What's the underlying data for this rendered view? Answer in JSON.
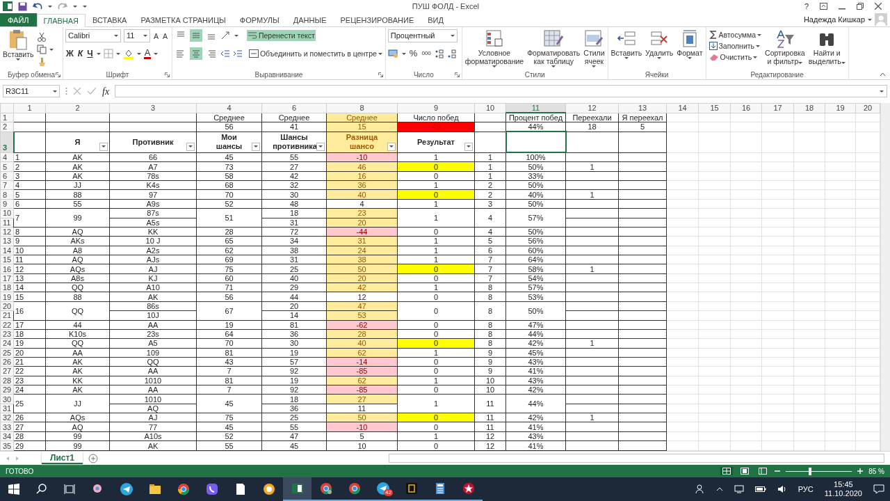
{
  "title_bar": {
    "title": "ПУШ ФОЛД - Excel",
    "help": "?"
  },
  "ribbon_tabs": [
    {
      "label": "ФАЙЛ",
      "kind": "file",
      "selected": false
    },
    {
      "label": "ГЛАВНАЯ",
      "kind": "tab",
      "selected": true
    },
    {
      "label": "ВСТАВКА",
      "kind": "tab",
      "selected": false
    },
    {
      "label": "РАЗМЕТКА СТРАНИЦЫ",
      "kind": "tab",
      "selected": false
    },
    {
      "label": "ФОРМУЛЫ",
      "kind": "tab",
      "selected": false
    },
    {
      "label": "ДАННЫЕ",
      "kind": "tab",
      "selected": false
    },
    {
      "label": "РЕЦЕНЗИРОВАНИЕ",
      "kind": "tab",
      "selected": false
    },
    {
      "label": "ВИД",
      "kind": "tab",
      "selected": false
    }
  ],
  "user": {
    "name": "Надежда Кишкар"
  },
  "ribbon_groups": [
    {
      "kind": "clipboard",
      "label": "Буфер обмена",
      "paste": "Вставить"
    },
    {
      "kind": "font",
      "label": "Шрифт",
      "font": "Calibri",
      "size": "11",
      "grow": "A",
      "shrink": "A",
      "bold": "Ж",
      "italic": "К",
      "underline": "Ч",
      "font_color": "A"
    },
    {
      "kind": "alignment",
      "label": "Выравнивание",
      "vertical": [
        {
          "selected": false
        },
        {
          "selected": true
        },
        {
          "selected": false
        }
      ],
      "horizontal": [
        {
          "selected": false
        },
        {
          "selected": true
        },
        {
          "selected": false
        }
      ],
      "wrap": {
        "label": "Перенести текст",
        "selected": true
      },
      "merge": "Объединить и поместить в центре"
    },
    {
      "kind": "number",
      "label": "Число",
      "format": "Процентный",
      "percent": "%",
      "thousands": "000"
    },
    {
      "kind": "styles",
      "label": "Стили",
      "buttons": [
        {
          "lines": [
            "Условное",
            "форматирование"
          ]
        },
        {
          "lines": [
            "Форматировать",
            "как таблицу"
          ]
        },
        {
          "lines": [
            "Стили",
            "ячеек"
          ]
        }
      ]
    },
    {
      "kind": "cells",
      "label": "Ячейки",
      "buttons": [
        {
          "lines": [
            "Вставить"
          ]
        },
        {
          "lines": [
            "Удалить"
          ]
        },
        {
          "lines": [
            "Формат"
          ]
        }
      ]
    },
    {
      "kind": "editing",
      "label": "Редактирование",
      "small": [
        "Автосумма",
        "Заполнить",
        "Очистить"
      ],
      "buttons": [
        {
          "lines": [
            "Сортировка",
            "и фильтр"
          ]
        },
        {
          "lines": [
            "Найти и",
            "выделить"
          ]
        }
      ]
    }
  ],
  "formula_bar": {
    "name_box": "R3C11",
    "fx": "fx"
  },
  "column_headers": [
    {
      "label": "1",
      "selected": false
    },
    {
      "label": "2",
      "selected": false
    },
    {
      "label": "3",
      "selected": false
    },
    {
      "label": "4",
      "selected": false
    },
    {
      "label": "6",
      "selected": false
    },
    {
      "label": "8",
      "selected": false
    },
    {
      "label": "9",
      "selected": false
    },
    {
      "label": "10",
      "selected": false
    },
    {
      "label": "11",
      "selected": true
    },
    {
      "label": "12",
      "selected": false
    },
    {
      "label": "13",
      "selected": false
    },
    {
      "label": "14",
      "selected": false
    },
    {
      "label": "15",
      "selected": false
    },
    {
      "label": "16",
      "selected": false
    },
    {
      "label": "17",
      "selected": false
    },
    {
      "label": "18",
      "selected": false
    },
    {
      "label": "19",
      "selected": false
    },
    {
      "label": "20",
      "selected": false
    }
  ],
  "summary_rows": [
    {
      "row": "1",
      "cells": [
        null,
        null,
        null,
        {
          "text": "Среднее",
          "kind": "plain"
        },
        {
          "text": "Среднее",
          "kind": "plain"
        },
        {
          "text": "Среднее",
          "kind": "neutral"
        },
        {
          "text": "Число побед",
          "kind": "plain"
        },
        null,
        {
          "text": "Процент побед",
          "kind": "plain"
        },
        {
          "text": "Переехали",
          "kind": "plain"
        },
        {
          "text": "Я переехал",
          "kind": "plain"
        }
      ]
    },
    {
      "row": "2",
      "cells": [
        null,
        null,
        null,
        {
          "text": "56",
          "kind": "plain"
        },
        {
          "text": "41",
          "kind": "plain"
        },
        {
          "text": "15",
          "kind": "neutral"
        },
        {
          "text": "49",
          "kind": "alert"
        },
        null,
        {
          "text": "44%",
          "kind": "plain"
        },
        {
          "text": "18",
          "kind": "plain"
        },
        {
          "text": "5",
          "kind": "plain"
        }
      ]
    }
  ],
  "header_row": {
    "row": "3",
    "selected": true,
    "cells": [
      {
        "filter": false,
        "selected": false
      },
      {
        "text": "Я",
        "filter": true,
        "selected": false
      },
      {
        "text": "Противник",
        "filter": true,
        "selected": false
      },
      {
        "text": "Мои шансы",
        "filter": true,
        "selected": false
      },
      {
        "text": "Шансы противника",
        "filter": true,
        "selected": false
      },
      {
        "text": "Разница шансо",
        "filter": true,
        "selected": false,
        "kind": "neutral"
      },
      {
        "text": "Результат",
        "filter": true,
        "selected": false
      },
      {
        "filter": false,
        "selected": false
      },
      {
        "filter": false,
        "selected": true
      },
      {
        "filter": false,
        "selected": false
      },
      {
        "filter": false,
        "selected": false
      }
    ]
  },
  "entries": [
    {
      "rows": [
        "4"
      ],
      "num": "1",
      "me": "AK",
      "opponents": [
        "66"
      ],
      "my": "45",
      "their": [
        "55"
      ],
      "diff": [
        {
          "text": "-10",
          "kind": "bad"
        }
      ],
      "result": {
        "text": "1",
        "highlight": false
      },
      "wins": "1",
      "pct": "100%"
    },
    {
      "rows": [
        "5"
      ],
      "num": "2",
      "me": "AK",
      "opponents": [
        "A7"
      ],
      "my": "73",
      "their": [
        "27"
      ],
      "diff": [
        {
          "text": "46",
          "kind": "neutral"
        }
      ],
      "result": {
        "text": "0",
        "highlight": true
      },
      "wins": "1",
      "pct": "50%",
      "moved": "1"
    },
    {
      "rows": [
        "6"
      ],
      "num": "3",
      "me": "AK",
      "opponents": [
        "78s"
      ],
      "my": "58",
      "their": [
        "42"
      ],
      "diff": [
        {
          "text": "16",
          "kind": "neutral"
        }
      ],
      "result": {
        "text": "0",
        "highlight": false
      },
      "wins": "1",
      "pct": "33%"
    },
    {
      "rows": [
        "7"
      ],
      "num": "4",
      "me": "JJ",
      "opponents": [
        "K4s"
      ],
      "my": "68",
      "their": [
        "32"
      ],
      "diff": [
        {
          "text": "36",
          "kind": "neutral"
        }
      ],
      "result": {
        "text": "1",
        "highlight": false
      },
      "wins": "2",
      "pct": "50%"
    },
    {
      "rows": [
        "8"
      ],
      "num": "5",
      "me": "88",
      "opponents": [
        "97"
      ],
      "my": "70",
      "their": [
        "30"
      ],
      "diff": [
        {
          "text": "40",
          "kind": "neutral"
        }
      ],
      "result": {
        "text": "0",
        "highlight": true
      },
      "wins": "2",
      "pct": "40%",
      "moved": "1"
    },
    {
      "rows": [
        "9"
      ],
      "num": "6",
      "me": "55",
      "opponents": [
        "A9s"
      ],
      "my": "52",
      "their": [
        "48"
      ],
      "diff": [
        {
          "text": "4",
          "kind": "plain"
        }
      ],
      "result": {
        "text": "1",
        "highlight": false
      },
      "wins": "3",
      "pct": "50%"
    },
    {
      "rows": [
        "10",
        "11"
      ],
      "num": "7",
      "me": "99",
      "opponents": [
        "87s",
        "A5s"
      ],
      "my": "51",
      "their": [
        "18",
        "31"
      ],
      "diff": [
        {
          "text": "23",
          "kind": "neutral"
        },
        {
          "text": "20",
          "kind": "neutral"
        }
      ],
      "result": {
        "text": "1",
        "highlight": false
      },
      "wins": "4",
      "pct": "57%"
    },
    {
      "rows": [
        "12"
      ],
      "num": "8",
      "me": "AQ",
      "opponents": [
        "KK"
      ],
      "my": "28",
      "their": [
        "72"
      ],
      "diff": [
        {
          "text": "-44",
          "kind": "bad"
        }
      ],
      "result": {
        "text": "0",
        "highlight": false
      },
      "wins": "4",
      "pct": "50%"
    },
    {
      "rows": [
        "13"
      ],
      "num": "9",
      "me": "AKs",
      "opponents": [
        "10 J"
      ],
      "my": "65",
      "their": [
        "34"
      ],
      "diff": [
        {
          "text": "31",
          "kind": "neutral"
        }
      ],
      "result": {
        "text": "1",
        "highlight": false
      },
      "wins": "5",
      "pct": "56%"
    },
    {
      "rows": [
        "14"
      ],
      "num": "10",
      "me": "A8",
      "opponents": [
        "A2s"
      ],
      "my": "62",
      "their": [
        "38"
      ],
      "diff": [
        {
          "text": "24",
          "kind": "neutral"
        }
      ],
      "result": {
        "text": "1",
        "highlight": false
      },
      "wins": "6",
      "pct": "60%"
    },
    {
      "rows": [
        "15"
      ],
      "num": "11",
      "me": "AQ",
      "opponents": [
        "AJs"
      ],
      "my": "69",
      "their": [
        "31"
      ],
      "diff": [
        {
          "text": "38",
          "kind": "neutral"
        }
      ],
      "result": {
        "text": "1",
        "highlight": false
      },
      "wins": "7",
      "pct": "64%"
    },
    {
      "rows": [
        "16"
      ],
      "num": "12",
      "me": "AQs",
      "opponents": [
        "AJ"
      ],
      "my": "75",
      "their": [
        "25"
      ],
      "diff": [
        {
          "text": "50",
          "kind": "neutral"
        }
      ],
      "result": {
        "text": "0",
        "highlight": true
      },
      "wins": "7",
      "pct": "58%",
      "moved": "1"
    },
    {
      "rows": [
        "17"
      ],
      "num": "13",
      "me": "A8s",
      "opponents": [
        "KJ"
      ],
      "my": "60",
      "their": [
        "40"
      ],
      "diff": [
        {
          "text": "20",
          "kind": "neutral"
        }
      ],
      "result": {
        "text": "0",
        "highlight": false
      },
      "wins": "7",
      "pct": "54%"
    },
    {
      "rows": [
        "18"
      ],
      "num": "14",
      "me": "QQ",
      "opponents": [
        "A10"
      ],
      "my": "71",
      "their": [
        "29"
      ],
      "diff": [
        {
          "text": "42",
          "kind": "neutral"
        }
      ],
      "result": {
        "text": "1",
        "highlight": false
      },
      "wins": "8",
      "pct": "57%"
    },
    {
      "rows": [
        "19"
      ],
      "num": "15",
      "me": "88",
      "opponents": [
        "AK"
      ],
      "my": "56",
      "their": [
        "44"
      ],
      "diff": [
        {
          "text": "12",
          "kind": "plain"
        }
      ],
      "result": {
        "text": "0",
        "highlight": false
      },
      "wins": "8",
      "pct": "53%"
    },
    {
      "rows": [
        "20",
        "21"
      ],
      "num": "16",
      "me": "QQ",
      "opponents": [
        "86s",
        "10J"
      ],
      "my": "67",
      "their": [
        "20",
        "14"
      ],
      "diff": [
        {
          "text": "47",
          "kind": "neutral"
        },
        {
          "text": "53",
          "kind": "neutral"
        }
      ],
      "result": {
        "text": "0",
        "highlight": false
      },
      "wins": "8",
      "pct": "50%"
    },
    {
      "rows": [
        "22"
      ],
      "num": "17",
      "me": "44",
      "opponents": [
        "AA"
      ],
      "my": "19",
      "their": [
        "81"
      ],
      "diff": [
        {
          "text": "-62",
          "kind": "bad"
        }
      ],
      "result": {
        "text": "0",
        "highlight": false
      },
      "wins": "8",
      "pct": "47%"
    },
    {
      "rows": [
        "23"
      ],
      "num": "18",
      "me": "K10s",
      "opponents": [
        "23s"
      ],
      "my": "64",
      "their": [
        "36"
      ],
      "diff": [
        {
          "text": "28",
          "kind": "neutral"
        }
      ],
      "result": {
        "text": "0",
        "highlight": false
      },
      "wins": "8",
      "pct": "44%"
    },
    {
      "rows": [
        "24"
      ],
      "num": "19",
      "me": "QQ",
      "opponents": [
        "A5"
      ],
      "my": "70",
      "their": [
        "30"
      ],
      "diff": [
        {
          "text": "40",
          "kind": "neutral"
        }
      ],
      "result": {
        "text": "0",
        "highlight": true
      },
      "wins": "8",
      "pct": "42%",
      "moved": "1"
    },
    {
      "rows": [
        "25"
      ],
      "num": "20",
      "me": "AA",
      "opponents": [
        "109"
      ],
      "my": "81",
      "their": [
        "19"
      ],
      "diff": [
        {
          "text": "62",
          "kind": "neutral"
        }
      ],
      "result": {
        "text": "1",
        "highlight": false
      },
      "wins": "9",
      "pct": "45%"
    },
    {
      "rows": [
        "26"
      ],
      "num": "21",
      "me": "AK",
      "opponents": [
        "QQ"
      ],
      "my": "43",
      "their": [
        "57"
      ],
      "diff": [
        {
          "text": "-14",
          "kind": "bad"
        }
      ],
      "result": {
        "text": "0",
        "highlight": false
      },
      "wins": "9",
      "pct": "43%"
    },
    {
      "rows": [
        "27"
      ],
      "num": "22",
      "me": "AK",
      "opponents": [
        "AA"
      ],
      "my": "7",
      "their": [
        "92"
      ],
      "diff": [
        {
          "text": "-85",
          "kind": "bad"
        }
      ],
      "result": {
        "text": "0",
        "highlight": false
      },
      "wins": "9",
      "pct": "41%"
    },
    {
      "rows": [
        "28"
      ],
      "num": "23",
      "me": "KK",
      "opponents": [
        "1010"
      ],
      "my": "81",
      "their": [
        "19"
      ],
      "diff": [
        {
          "text": "62",
          "kind": "neutral"
        }
      ],
      "result": {
        "text": "1",
        "highlight": false
      },
      "wins": "10",
      "pct": "43%"
    },
    {
      "rows": [
        "29"
      ],
      "num": "24",
      "me": "AK",
      "opponents": [
        "AA"
      ],
      "my": "7",
      "their": [
        "92"
      ],
      "diff": [
        {
          "text": "-85",
          "kind": "bad"
        }
      ],
      "result": {
        "text": "0",
        "highlight": false
      },
      "wins": "10",
      "pct": "42%"
    },
    {
      "rows": [
        "30",
        "31"
      ],
      "num": "25",
      "me": "JJ",
      "opponents": [
        "1010",
        "AQ"
      ],
      "my": "45",
      "their": [
        "18",
        "36"
      ],
      "diff": [
        {
          "text": "27",
          "kind": "neutral"
        },
        {
          "text": "11",
          "kind": "plain"
        }
      ],
      "result": {
        "text": "1",
        "highlight": false
      },
      "wins": "11",
      "pct": "44%"
    },
    {
      "rows": [
        "32"
      ],
      "num": "26",
      "me": "AQs",
      "opponents": [
        "AJ"
      ],
      "my": "75",
      "their": [
        "25"
      ],
      "diff": [
        {
          "text": "50",
          "kind": "neutral"
        }
      ],
      "result": {
        "text": "0",
        "highlight": true
      },
      "wins": "11",
      "pct": "42%",
      "moved": "1"
    },
    {
      "rows": [
        "33"
      ],
      "num": "27",
      "me": "AQ",
      "opponents": [
        "77"
      ],
      "my": "45",
      "their": [
        "55"
      ],
      "diff": [
        {
          "text": "-10",
          "kind": "bad"
        }
      ],
      "result": {
        "text": "0",
        "highlight": false
      },
      "wins": "11",
      "pct": "41%"
    },
    {
      "rows": [
        "34"
      ],
      "num": "28",
      "me": "99",
      "opponents": [
        "A10s"
      ],
      "my": "52",
      "their": [
        "47"
      ],
      "diff": [
        {
          "text": "5",
          "kind": "plain"
        }
      ],
      "result": {
        "text": "1",
        "highlight": false
      },
      "wins": "12",
      "pct": "43%"
    },
    {
      "rows": [
        "35"
      ],
      "num": "29",
      "me": "99",
      "opponents": [
        "AK"
      ],
      "my": "55",
      "their": [
        "45"
      ],
      "diff": [
        {
          "text": "10",
          "kind": "plain"
        }
      ],
      "result": {
        "text": "0",
        "highlight": false
      },
      "wins": "12",
      "pct": "41%"
    }
  ],
  "sheet_tabs": [
    {
      "label": "Лист1",
      "selected": true
    }
  ],
  "status_bar": {
    "mode": "ГОТОВО",
    "views": [
      {
        "selected": true
      },
      {
        "selected": false
      },
      {
        "selected": false
      }
    ],
    "zoom": {
      "level": 0.37
    },
    "zoom_label": "85 %"
  },
  "taskbar": {
    "apps": [
      {
        "running": false,
        "active": false
      },
      {
        "running": false,
        "active": false
      },
      {
        "running": false,
        "active": false
      },
      {
        "running": false,
        "active": false
      },
      {
        "running": false,
        "active": false
      },
      {
        "running": false,
        "active": false
      },
      {
        "running": false,
        "active": false
      },
      {
        "running": true,
        "active": true
      },
      {
        "running": true,
        "active": false
      },
      {
        "running": true,
        "active": false
      },
      {
        "running": true,
        "active": false,
        "badge": "42"
      },
      {
        "running": true,
        "active": false
      },
      {
        "running": true,
        "active": false
      },
      {
        "running": true,
        "active": false
      }
    ],
    "language": "РУС",
    "time": "15:45",
    "date": "11.10.2020"
  }
}
